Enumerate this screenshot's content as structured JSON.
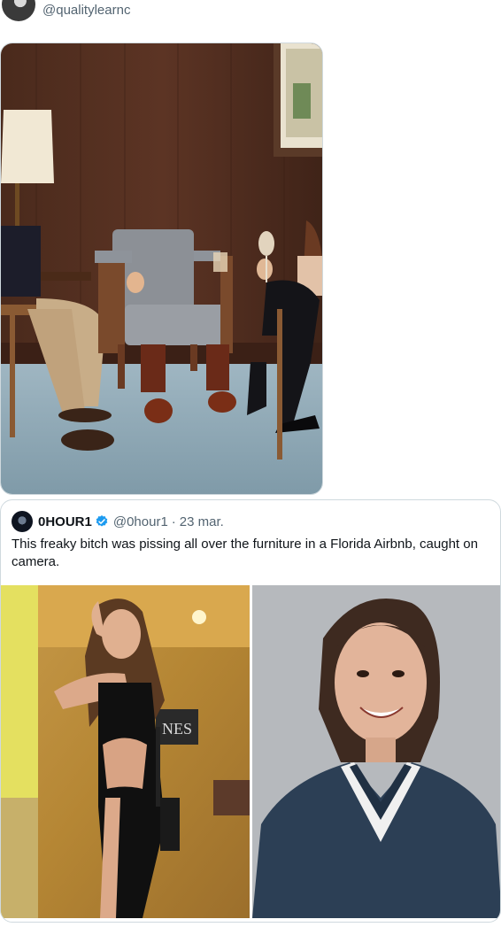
{
  "tweet": {
    "handle": "@qualitylearnc",
    "media_alt": "photo-three-people-chairs"
  },
  "quoted": {
    "name": "0HOUR1",
    "handle": "@0hour1",
    "separator": "·",
    "date": "23 mar.",
    "text": "This freaky bitch was pissing all over the furniture in a Florida Airbnb, caught on camera.",
    "sign_text": "NES"
  },
  "colors": {
    "verified": "#1d9bf0",
    "secondary_text": "#536471",
    "border": "#cfd9de"
  }
}
